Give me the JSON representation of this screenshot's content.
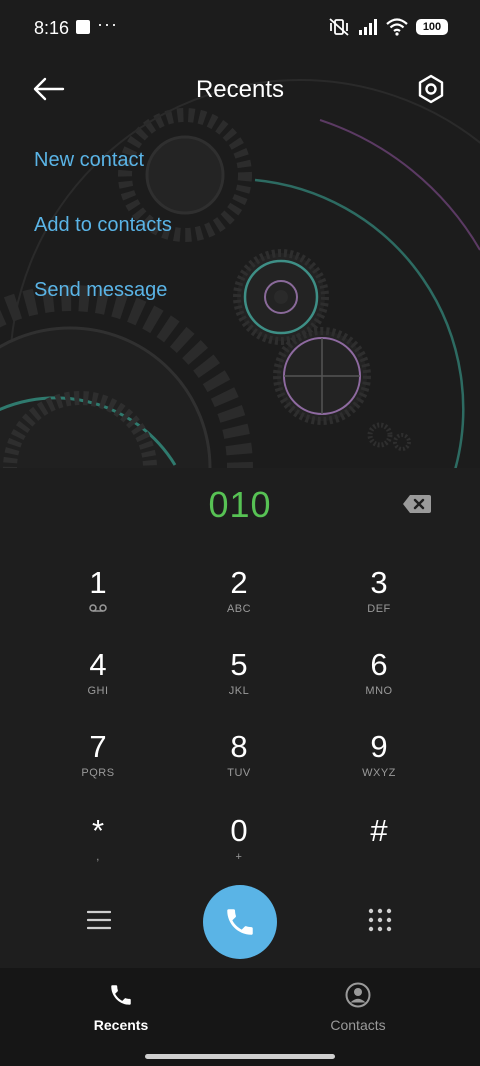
{
  "status_bar": {
    "time": "8:16",
    "more": "···",
    "battery": "100"
  },
  "header": {
    "title": "Recents"
  },
  "actions": {
    "new_contact": "New contact",
    "add_to_contacts": "Add to contacts",
    "send_message": "Send message"
  },
  "dialer": {
    "number": "010",
    "keys": [
      {
        "digit": "1",
        "letters": ""
      },
      {
        "digit": "2",
        "letters": "ABC"
      },
      {
        "digit": "3",
        "letters": "DEF"
      },
      {
        "digit": "4",
        "letters": "GHI"
      },
      {
        "digit": "5",
        "letters": "JKL"
      },
      {
        "digit": "6",
        "letters": "MNO"
      },
      {
        "digit": "7",
        "letters": "PQRS"
      },
      {
        "digit": "8",
        "letters": "TUV"
      },
      {
        "digit": "9",
        "letters": "WXYZ"
      },
      {
        "digit": "*",
        "letters": ","
      },
      {
        "digit": "0",
        "letters": "+"
      },
      {
        "digit": "#",
        "letters": ""
      }
    ]
  },
  "bottom_nav": {
    "recents": "Recents",
    "contacts": "Contacts"
  },
  "colors": {
    "accent": "#5ab4e6",
    "number": "#57c254",
    "background": "#1e1e1e"
  }
}
